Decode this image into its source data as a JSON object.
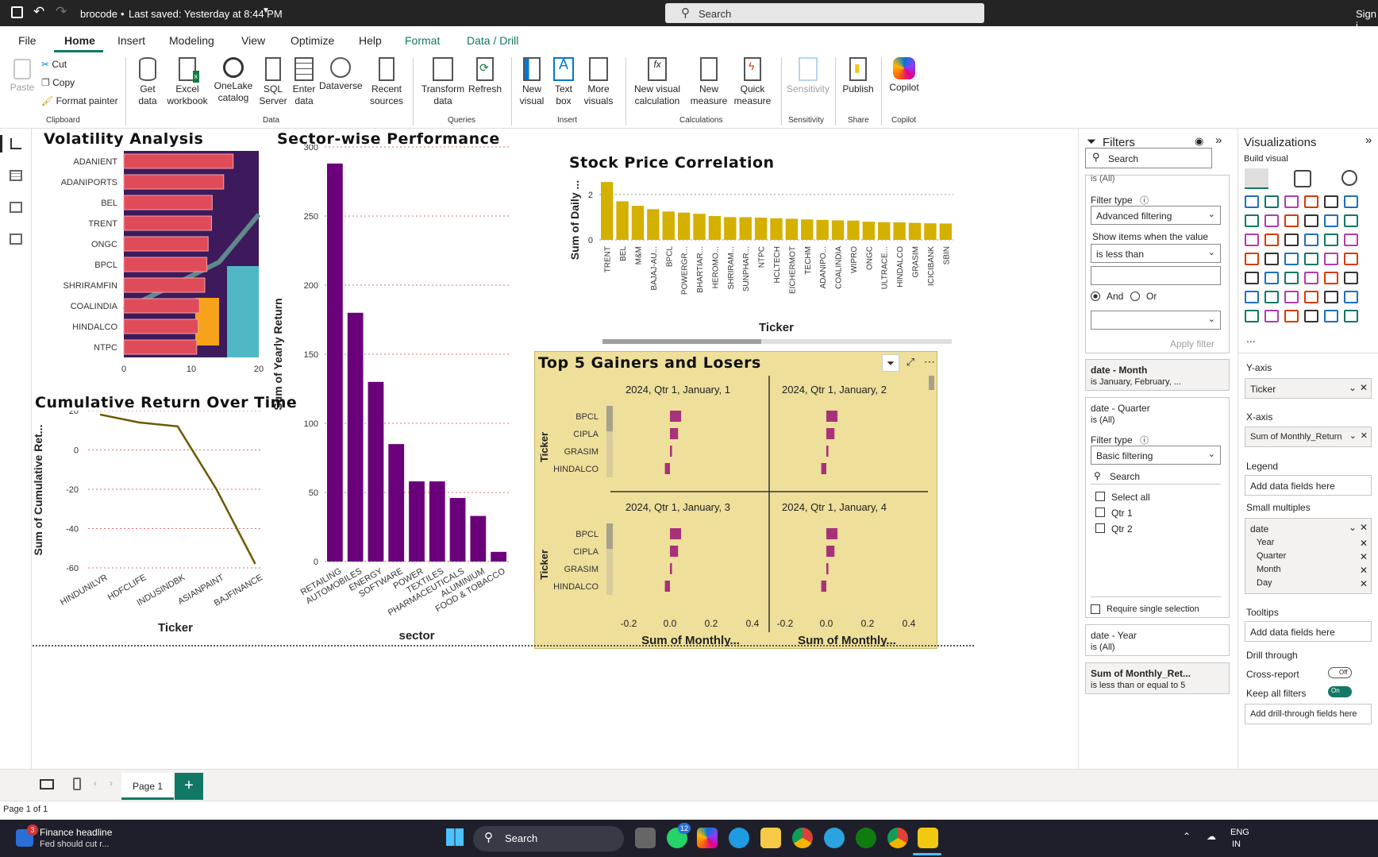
{
  "titlebar": {
    "file_name": "brocode",
    "saved_status": "Last saved: Yesterday at 8:44 PM",
    "search_placeholder": "Search",
    "sign_in": "Sign i"
  },
  "tabs": [
    "File",
    "Home",
    "Insert",
    "Modeling",
    "View",
    "Optimize",
    "Help",
    "Format",
    "Data / Drill"
  ],
  "ribbon": {
    "clipboard": {
      "paste": "Paste",
      "cut": "Cut",
      "copy": "Copy",
      "format_painter": "Format painter",
      "group": "Clipboard"
    },
    "data": {
      "get_data": "Get data",
      "excel": "Excel workbook",
      "onelake": "OneLake catalog",
      "sql": "SQL Server",
      "enter": "Enter data",
      "dataverse": "Dataverse",
      "recent": "Recent sources",
      "group": "Data"
    },
    "queries": {
      "transform": "Transform data",
      "refresh": "Refresh",
      "group": "Queries"
    },
    "insert": {
      "new_visual": "New visual",
      "text_box": "Text box",
      "more_visuals": "More visuals",
      "group": "Insert"
    },
    "calculations": {
      "new_visual_calc": "New visual calculation",
      "new_measure": "New measure",
      "quick_measure": "Quick measure",
      "group": "Calculations"
    },
    "sensitivity": {
      "label": "Sensitivity",
      "group": "Sensitivity"
    },
    "share": {
      "publish": "Publish",
      "group": "Share"
    },
    "copilot": {
      "label": "Copilot",
      "group": "Copilot"
    }
  },
  "charts": {
    "volatility": {
      "title": "Volatility Analysis"
    },
    "sector": {
      "title": "Sector-wise Performance"
    },
    "correlation": {
      "title": "Stock Price Correlation"
    },
    "cumulative": {
      "title": "Cumulative Return Over Time"
    },
    "gainers": {
      "title": "Top 5 Gainers and Losers"
    }
  },
  "chart_data": [
    {
      "type": "bar",
      "title": "Volatility Analysis",
      "orientation": "horizontal",
      "categories": [
        "ADANIENT",
        "ADANIPORTS",
        "BEL",
        "TRENT",
        "ONGC",
        "BPCL",
        "SHRIRAMFIN",
        "COALINDIA",
        "HINDALCO",
        "NTPC"
      ],
      "values": [
        16.2,
        14.8,
        13.1,
        13.0,
        12.5,
        12.3,
        12.0,
        11.2,
        11.0,
        10.8
      ],
      "xlim": [
        0,
        20
      ],
      "xticks": [
        "0",
        "10",
        "20"
      ]
    },
    {
      "type": "bar",
      "title": "Sector-wise Performance",
      "xlabel": "sector",
      "ylabel": "Sum of Yearly Return",
      "categories": [
        "RETAILING",
        "AUTOMOBILES",
        "ENERGY",
        "SOFTWARE",
        "POWER",
        "TEXTILES",
        "PHARMACEUTICALS",
        "ALUMINIUM",
        "FOOD & TOBACCO"
      ],
      "values": [
        288,
        180,
        130,
        85,
        58,
        58,
        46,
        33,
        7
      ],
      "ylim": [
        0,
        300
      ],
      "yticks": [
        "0",
        "50",
        "100",
        "150",
        "200",
        "250",
        "300"
      ],
      "color": "#6b007b"
    },
    {
      "type": "bar",
      "title": "Stock Price Correlation",
      "xlabel": "Ticker",
      "ylabel": "Sum of Daily ...",
      "categories": [
        "TRENT",
        "BEL",
        "M&M",
        "BAJAJ-AU...",
        "BPCL",
        "POWERGR...",
        "BHARTIAR...",
        "HEROMO...",
        "SHRIRAM...",
        "SUNPHAR...",
        "NTPC",
        "HCLTECH",
        "EICHERMOT",
        "TECHM",
        "ADANIPO...",
        "COALINDIA",
        "WIPRO",
        "ONGC",
        "ULTRACE...",
        "HINDALCO",
        "GRASIM",
        "ICICIBANK",
        "SBIN"
      ],
      "values": [
        2.55,
        1.7,
        1.5,
        1.35,
        1.25,
        1.2,
        1.15,
        1.05,
        1.0,
        1.0,
        0.98,
        0.95,
        0.93,
        0.9,
        0.88,
        0.86,
        0.85,
        0.8,
        0.78,
        0.77,
        0.75,
        0.73,
        0.72
      ],
      "ylim": [
        0,
        2.8
      ],
      "yticks": [
        "0",
        "2"
      ],
      "color": "#d4b000"
    },
    {
      "type": "line",
      "title": "Cumulative Return Over Time",
      "xlabel": "Ticker",
      "ylabel": "Sum of Cumulative Ret...",
      "categories": [
        "HINDUNILVR",
        "HDFCLIFE",
        "INDUSINDBK",
        "ASIANPAINT",
        "BAJFINANCE"
      ],
      "values": [
        18,
        14,
        12,
        -20,
        -58
      ],
      "ylim": [
        -60,
        20
      ],
      "yticks": [
        "20",
        "0",
        "-20",
        "-40",
        "-60"
      ],
      "color": "#6b5a00"
    },
    {
      "type": "bar",
      "title": "Top 5 Gainers and Losers",
      "orientation": "horizontal",
      "ylabel": "Ticker",
      "xlabel": "Sum of Monthly...",
      "panels": [
        {
          "name": "2024, Qtr 1, January, 1"
        },
        {
          "name": "2024, Qtr 1, January, 2"
        },
        {
          "name": "2024, Qtr 1, January, 3"
        },
        {
          "name": "2024, Qtr 1, January, 4"
        }
      ],
      "categories": [
        "BPCL",
        "CIPLA",
        "GRASIM",
        "HINDALCO"
      ],
      "values": [
        0.11,
        0.08,
        0.02,
        -0.05
      ],
      "xticks": [
        "-0.2",
        "0.0",
        "0.2",
        "0.4"
      ],
      "color": "#a83279"
    }
  ],
  "filters": {
    "title": "Filters",
    "search": "Search",
    "is_all_top": "is (All)",
    "filter_type_label": "Filter type",
    "adv_filtering": "Advanced filtering",
    "show_items": "Show items when the value",
    "is_less_than": "is less than",
    "and": "And",
    "or": "Or",
    "apply_filter": "Apply filter",
    "month_title": "date - Month",
    "month_value": "is January, February, ...",
    "quarter_title": "date - Quarter",
    "quarter_value": "is (All)",
    "basic_filtering": "Basic filtering",
    "search2": "Search",
    "select_all": "Select all",
    "qtr1": "Qtr 1",
    "qtr2": "Qtr 2",
    "require_single": "Require single selection",
    "year_title": "date - Year",
    "year_value": "is (All)",
    "sum_title": "Sum of Monthly_Ret...",
    "sum_value": "is less than or equal to 5"
  },
  "viz": {
    "title": "Visualizations",
    "build": "Build visual",
    "yaxis": "Y-axis",
    "yaxis_field": "Ticker",
    "xaxis": "X-axis",
    "xaxis_field": "Sum of Monthly_Return",
    "legend": "Legend",
    "add_fields": "Add data fields here",
    "small_multiples": "Small multiples",
    "sm_field": "date",
    "sm_sub": [
      "Year",
      "Quarter",
      "Month",
      "Day"
    ],
    "tooltips": "Tooltips",
    "add_fields2": "Add data fields here",
    "drill": "Drill through",
    "cross_report": "Cross-report",
    "cross_state": "Off",
    "keep_all": "Keep all filters",
    "keep_state": "On",
    "add_drill": "Add drill-through fields here",
    "more": "..."
  },
  "pages": {
    "page1": "Page 1",
    "status": "Page 1 of 1",
    "add": "+"
  },
  "taskbar": {
    "news_title": "Finance headline",
    "news_sub": "Fed should cut r...",
    "badge": "3",
    "search": "Search",
    "wa_badge": "12",
    "lang1": "ENG",
    "lang2": "IN"
  }
}
